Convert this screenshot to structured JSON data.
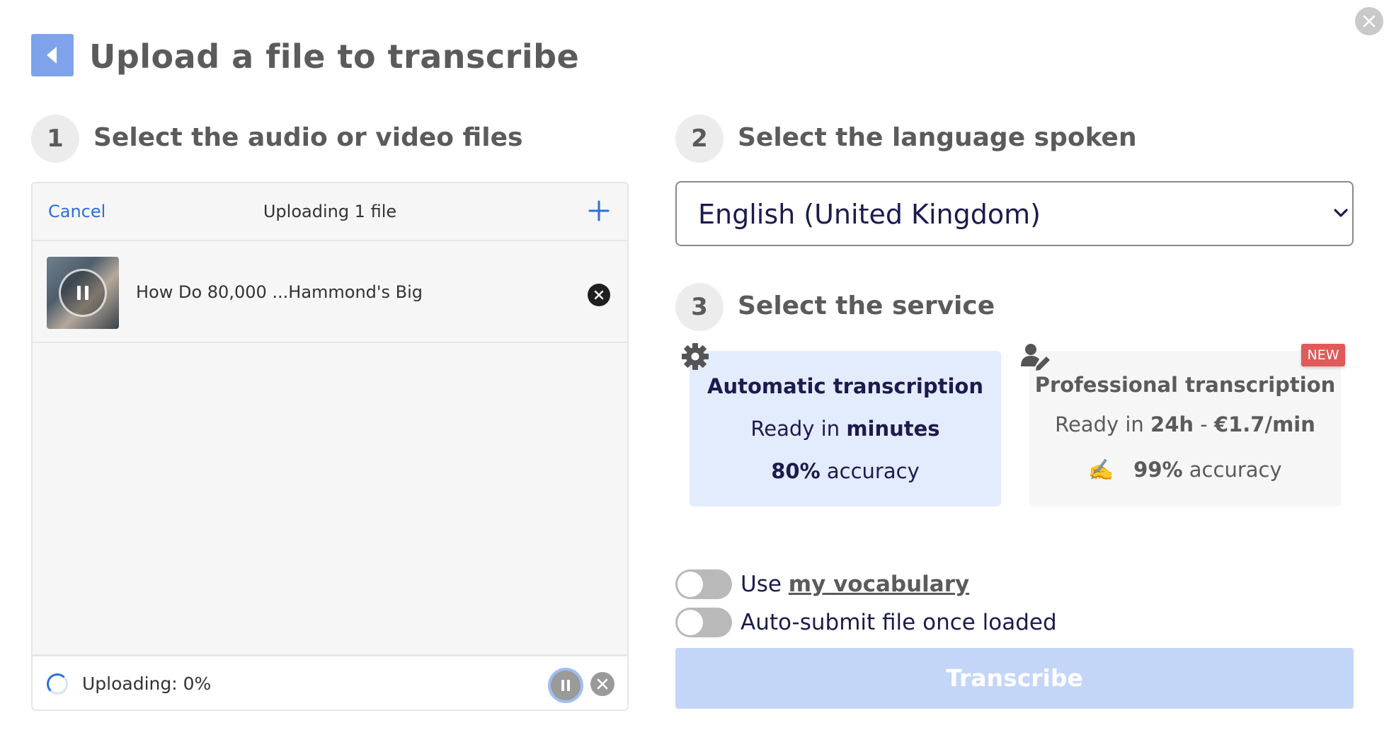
{
  "header": {
    "title": "Upload a file to transcribe",
    "back_icon": "chevron-left-icon",
    "close_icon": "close-icon"
  },
  "steps": [
    {
      "number": "1",
      "title": "Select the audio or video files"
    },
    {
      "number": "2",
      "title": "Select the language spoken"
    },
    {
      "number": "3",
      "title": "Select the service"
    }
  ],
  "uploader": {
    "cancel_label": "Cancel",
    "status_title": "Uploading 1 file",
    "add_icon": "plus-icon",
    "files": [
      {
        "name": "How Do 80,000 ...Hammond's Big",
        "state": "paused"
      }
    ],
    "footer_status": "Uploading: 0%",
    "progress_percent": 0
  },
  "language": {
    "selected": "English (United Kingdom)"
  },
  "services": {
    "automatic": {
      "title": "Automatic transcription",
      "ready_prefix": "Ready in ",
      "ready_value": "minutes",
      "accuracy_value": "80%",
      "accuracy_suffix": " accuracy",
      "icon": "gear-icon",
      "selected": true
    },
    "professional": {
      "title": "Professional transcription",
      "ready_prefix": "Ready in ",
      "ready_value": "24h",
      "price_sep": " - ",
      "price": "€1.7/min",
      "emoji": "✍️",
      "accuracy_value": "99%",
      "accuracy_suffix": " accuracy",
      "badge": "NEW",
      "icon": "person-edit-icon",
      "selected": false
    }
  },
  "options": {
    "vocab_prefix": "Use ",
    "vocab_link": "my vocabulary",
    "vocab_enabled": false,
    "autosubmit_label": "Auto-submit file once loaded",
    "autosubmit_enabled": false
  },
  "transcribe_label": "Transcribe",
  "colors": {
    "accent": "#2a6fdb",
    "back_button": "#7ea3ea",
    "selected_card": "#e3ecfd",
    "transcribe_disabled": "#c4d6f7",
    "badge_red": "#e05a5a",
    "navy_text": "#1b1b4f"
  }
}
